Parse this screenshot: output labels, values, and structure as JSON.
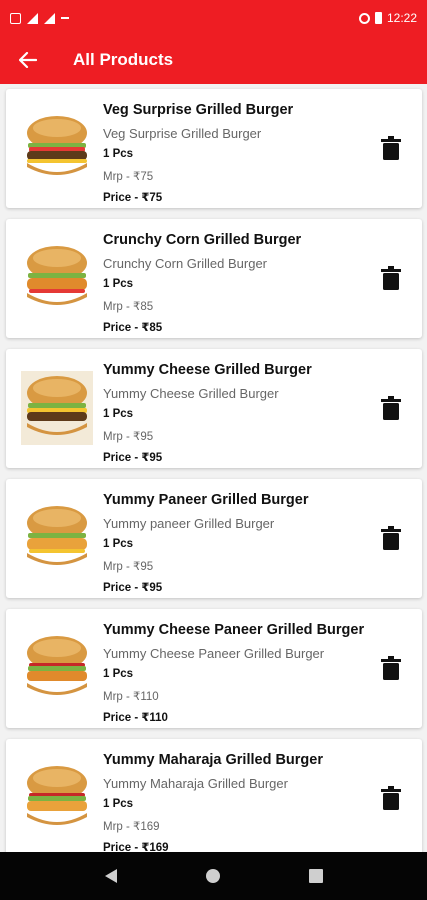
{
  "status_bar": {
    "time": "12:22"
  },
  "app_bar": {
    "title": "All Products",
    "back_icon": "arrow-left-icon"
  },
  "products": [
    {
      "name": "Veg Surprise Grilled Burger",
      "description": "Veg Surprise Grilled Burger",
      "quantity": "1 Pcs",
      "mrp": "Mrp - ₹75",
      "price": "Price - ₹75"
    },
    {
      "name": "Crunchy Corn Grilled Burger",
      "description": "Crunchy Corn Grilled Burger",
      "quantity": "1 Pcs",
      "mrp": "Mrp - ₹85",
      "price": "Price - ₹85"
    },
    {
      "name": "Yummy Cheese Grilled Burger",
      "description": "Yummy Cheese Grilled Burger",
      "quantity": "1 Pcs",
      "mrp": "Mrp - ₹95",
      "price": "Price - ₹95"
    },
    {
      "name": "Yummy Paneer Grilled Burger",
      "description": "Yummy paneer Grilled Burger",
      "quantity": "1 Pcs",
      "mrp": "Mrp - ₹95",
      "price": "Price - ₹95"
    },
    {
      "name": "Yummy Cheese Paneer Grilled Burger",
      "description": "Yummy Cheese Paneer Grilled Burger",
      "quantity": "1 Pcs",
      "mrp": "Mrp - ₹110",
      "price": "Price - ₹110"
    },
    {
      "name": "Yummy Maharaja Grilled Burger",
      "description": "Yummy Maharaja Grilled Burger",
      "quantity": "1 Pcs",
      "mrp": "Mrp - ₹169",
      "price": "Price - ₹169"
    }
  ],
  "icons": {
    "delete": "trash-icon",
    "product_image": "burger-image"
  },
  "colors": {
    "accent": "#ee1d23",
    "navbar": "#050505"
  },
  "nav_bar": {
    "back": "nav-back-icon",
    "home": "nav-home-icon",
    "recents": "nav-recents-icon"
  }
}
